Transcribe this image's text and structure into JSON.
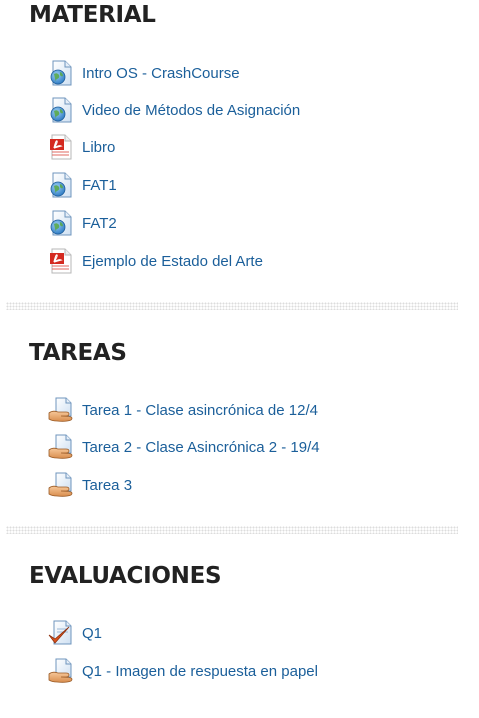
{
  "sections": [
    {
      "title": "MATERIAL",
      "items": [
        {
          "label": "Intro OS - CrashCourse",
          "icon": "url-globe-icon"
        },
        {
          "label": "Video de Métodos de Asignación",
          "icon": "url-globe-icon"
        },
        {
          "label": "Libro",
          "icon": "pdf-icon"
        },
        {
          "label": "FAT1",
          "icon": "url-globe-icon"
        },
        {
          "label": "FAT2",
          "icon": "url-globe-icon"
        },
        {
          "label": "Ejemplo de Estado del Arte",
          "icon": "pdf-icon"
        }
      ]
    },
    {
      "title": "TAREAS",
      "items": [
        {
          "label": "Tarea 1 - Clase asincrónica de 12/4",
          "icon": "assignment-hand-icon"
        },
        {
          "label": "Tarea 2 - Clase Asincrónica 2 - 19/4",
          "icon": "assignment-hand-icon"
        },
        {
          "label": "Tarea 3",
          "icon": "assignment-hand-icon"
        }
      ]
    },
    {
      "title": "EVALUACIONES",
      "items": [
        {
          "label": "Q1",
          "icon": "quiz-check-icon"
        },
        {
          "label": "Q1 - Imagen de respuesta en papel",
          "icon": "assignment-hand-icon"
        }
      ]
    }
  ],
  "colors": {
    "link": "#1b5f9a",
    "heading": "#222222",
    "divider": "#dcdcdc"
  }
}
